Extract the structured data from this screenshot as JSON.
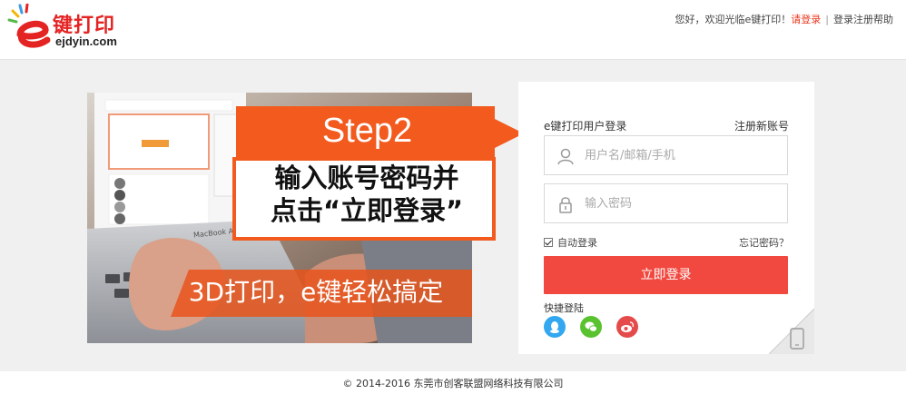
{
  "header": {
    "logo_cn": "键打印",
    "logo_en": "ejdyin.com",
    "welcome": "您好，欢迎光临e键打印！",
    "login_link": "请登录",
    "separator": "|",
    "help_link": "登录注册帮助"
  },
  "banner": {
    "step_title": "Step2",
    "step_desc_line1": "输入账号密码并",
    "step_desc_line2": "点击“立即登录”",
    "slogan": "3D打印，e键轻松搞定",
    "laptop_label": "MacBook Air"
  },
  "login": {
    "title": "e键打印用户登录",
    "register_link": "注册新账号",
    "username_placeholder": "用户名/邮箱/手机",
    "password_placeholder": "输入密码",
    "remember_label": "自动登录",
    "remember_checked": true,
    "forgot_link": "忘记密码？",
    "submit_label": "立即登录",
    "quick_login_label": "快捷登陆",
    "social": [
      "qq-icon",
      "wechat-icon",
      "weibo-icon"
    ],
    "accent_color": "#f1483f"
  },
  "footer": {
    "copyright": "© 2014-2016 东莞市创客联盟网络科技有限公司"
  }
}
